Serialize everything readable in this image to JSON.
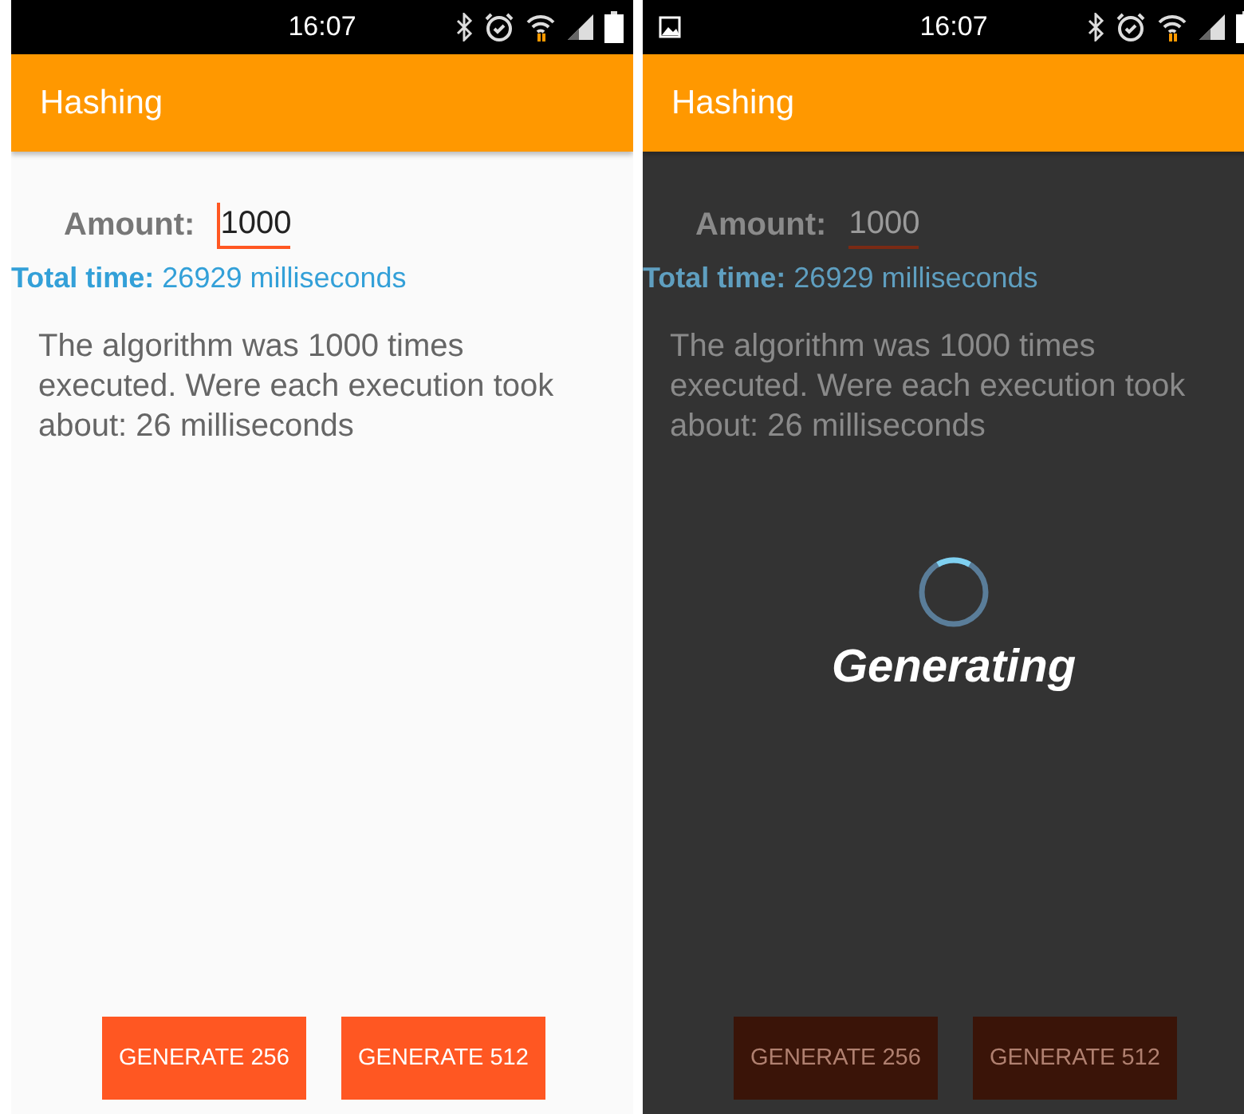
{
  "screens": [
    {
      "status_bar": {
        "time": "16:07",
        "notification": false
      },
      "app_bar": {
        "title": "Hashing"
      },
      "amount": {
        "label": "Amount:",
        "value": "1000",
        "focused": true
      },
      "total_time": "**Total time:** 26929 milliseconds",
      "description": "The algorithm was 1000 times executed. Were each execution took about: 26 milliseconds",
      "buttons": [
        "GENERATE 256",
        "GENERATE 512"
      ]
    },
    {
      "status_bar": {
        "time": "16:07",
        "notification": true
      },
      "app_bar": {
        "title": "Hashing"
      },
      "amount": {
        "label": "Amount:",
        "value": "1000",
        "focused": false
      },
      "total_time": "**Total time:** 26929 milliseconds",
      "description": "The algorithm was 1000 times executed. Were each execution took about: 26 milliseconds",
      "buttons": [
        "GENERATE 256",
        "GENERATE 512"
      ],
      "loading": {
        "message": "Generating"
      }
    }
  ]
}
